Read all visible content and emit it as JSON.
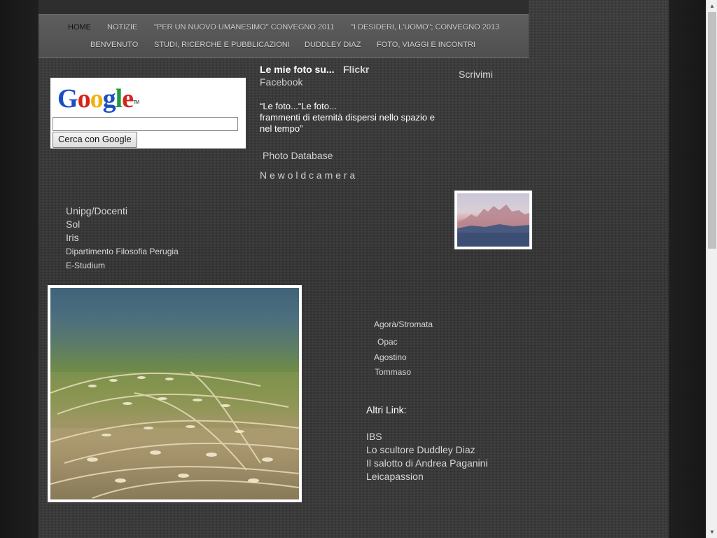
{
  "nav": {
    "items": [
      {
        "label": "HOME"
      },
      {
        "label": "NOTIZIE"
      },
      {
        "label": "\"PER UN NUOVO UMANESIMO\" CONVEGNO 2011"
      },
      {
        "label": "\"I DESIDERI, L'UOMO\"; CONVEGNO 2013"
      },
      {
        "label": "BENVENUTO"
      },
      {
        "label": "STUDI, RICERCHE E PUBBLICAZIONI"
      },
      {
        "label": "DUDDLEY DIAZ"
      },
      {
        "label": "FOTO, VIAGGI E INCONTRI"
      }
    ]
  },
  "search": {
    "logo_letters": [
      "G",
      "o",
      "o",
      "g",
      "l",
      "e"
    ],
    "logo_tm": "TM",
    "input_value": "",
    "button_label": "Cerca con Google"
  },
  "photos_block": {
    "heading": "Le mie foto su...",
    "flickr": "Flickr",
    "facebook": "Facebook",
    "quote_line1": "“Le foto...“Le foto...",
    "quote_line2": "frammenti di eternità dispersi nello spazio e",
    "quote_line3": "nel tempo”",
    "photo_database": "Photo Database",
    "newoldcamera": "N e w o l d c a m e r a"
  },
  "contact": {
    "scrivimi": "Scrivimi"
  },
  "uni_links": [
    {
      "label": "Unipg/Docenti"
    },
    {
      "label": "Sol"
    },
    {
      "label": "Iris"
    },
    {
      "label": "Dipartimento Filosofia Perugia"
    },
    {
      "label": "E-Studium"
    }
  ],
  "study_links": [
    {
      "label": "Agorà/Stromata"
    },
    {
      "label": "Opac"
    },
    {
      "label": "Agostino"
    },
    {
      "label": "Tommaso"
    }
  ],
  "other_links": {
    "heading": "Altri Link:",
    "items": [
      {
        "label": "IBS"
      },
      {
        "label": "Lo scultore Duddley Diaz"
      },
      {
        "label": "Il salotto di Andrea Paganini"
      },
      {
        "label": "Leicapassion"
      }
    ]
  },
  "colors": {
    "google": [
      "#1a4fc4",
      "#d6231d",
      "#f1b30b",
      "#1a4fc4",
      "#1e9a3d",
      "#d6231d"
    ]
  }
}
